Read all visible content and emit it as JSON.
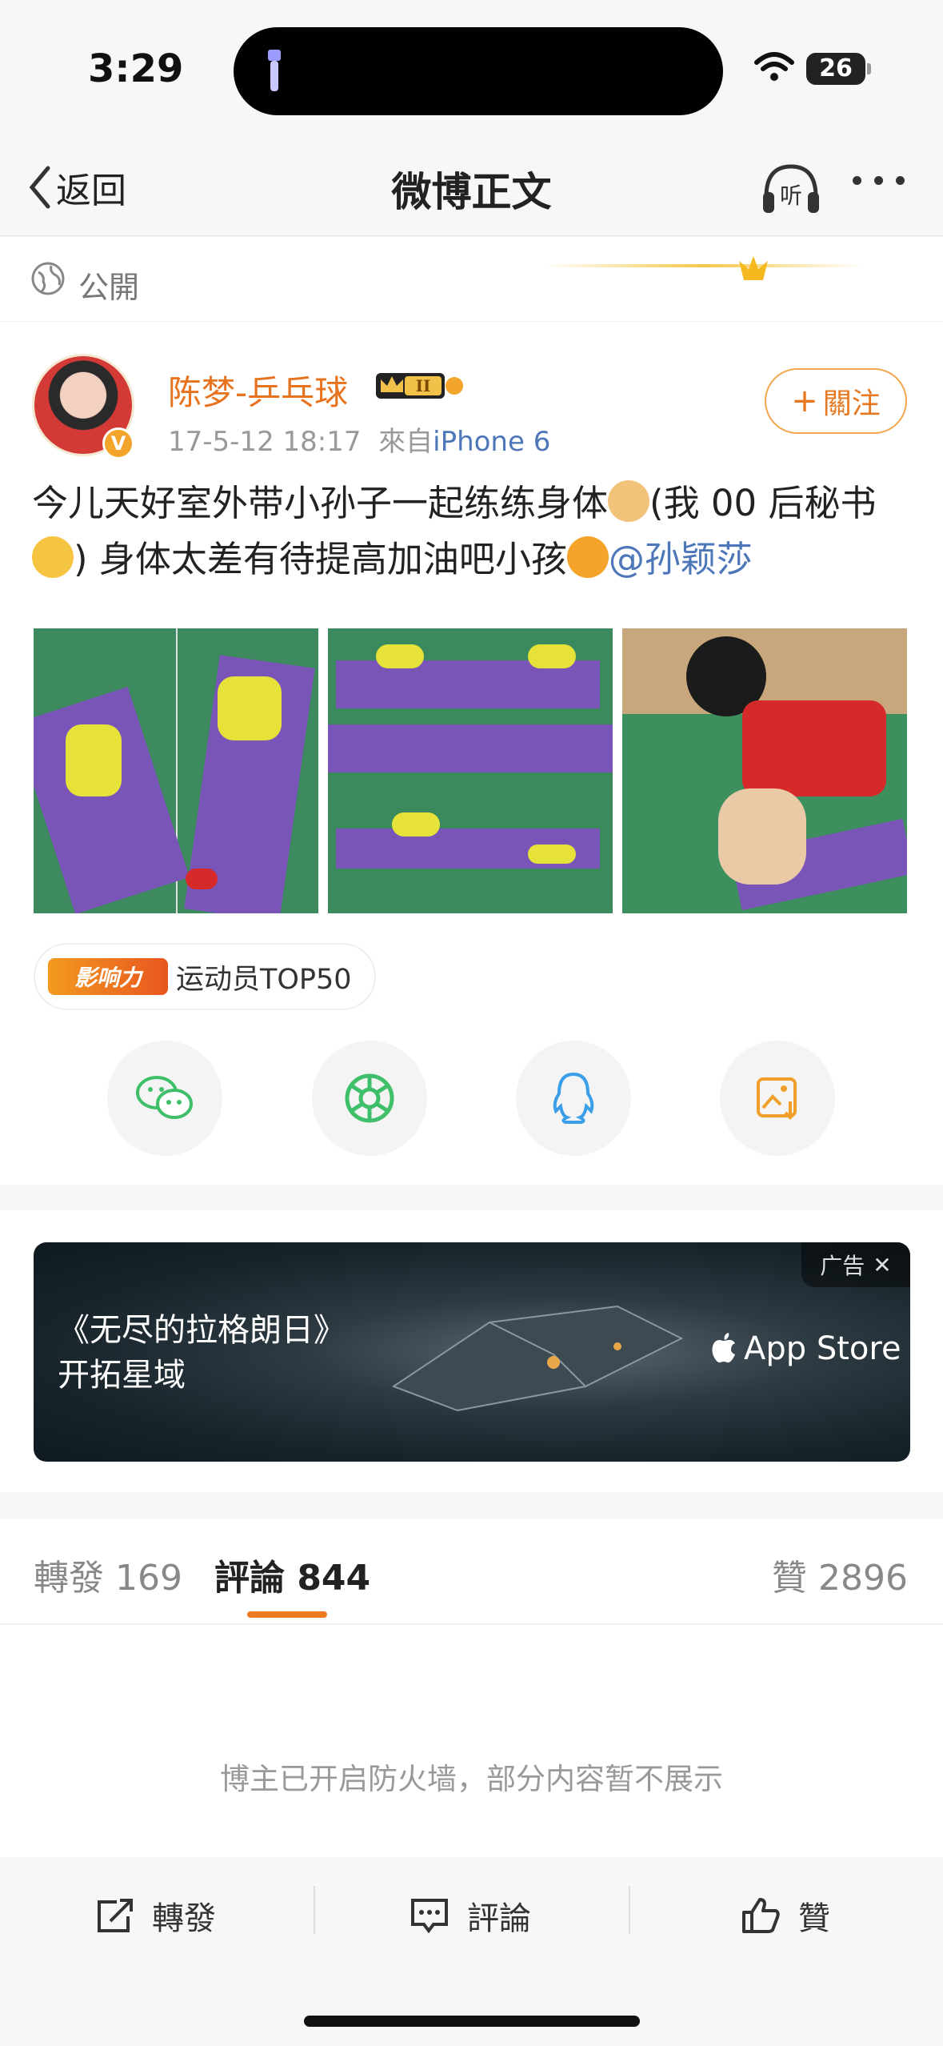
{
  "status_bar": {
    "time": "3:29",
    "battery": "26"
  },
  "nav": {
    "back_label": "返回",
    "title": "微博正文",
    "listen_label": "听"
  },
  "visibility": {
    "label": "公開"
  },
  "post": {
    "username": "陈梦-乒乓球",
    "level": "II",
    "timestamp": "17-5-12 18:17",
    "source_prefix": "來自",
    "source": "iPhone 6",
    "follow_label": "關注",
    "text_part1": "今儿天好室外带小孙子一起练练身体",
    "text_part2": "(我 00 后秘书",
    "text_part3": ") 身体太差有待提高加油吧小孩",
    "mention": "@孙颖莎",
    "influence_logo": "影响力",
    "influence_label": "运动员TOP50"
  },
  "share_icons": [
    "wechat-icon",
    "moments-icon",
    "qq-icon",
    "save-image-icon"
  ],
  "ad": {
    "title_line1": "《无尽的拉格朗日》",
    "title_line2": "开拓星域",
    "store": "App Store",
    "tag": "广告"
  },
  "tabs": {
    "repost": "轉發 169",
    "comments": "評論 844",
    "likes": "贊 2896"
  },
  "comments_notice": "博主已开启防火墙，部分内容暂不展示",
  "actions": {
    "repost": "轉發",
    "comment": "評論",
    "like": "贊"
  },
  "colors": {
    "accent": "#f07a1f",
    "link": "#4d77b8",
    "username": "#e8731f"
  }
}
